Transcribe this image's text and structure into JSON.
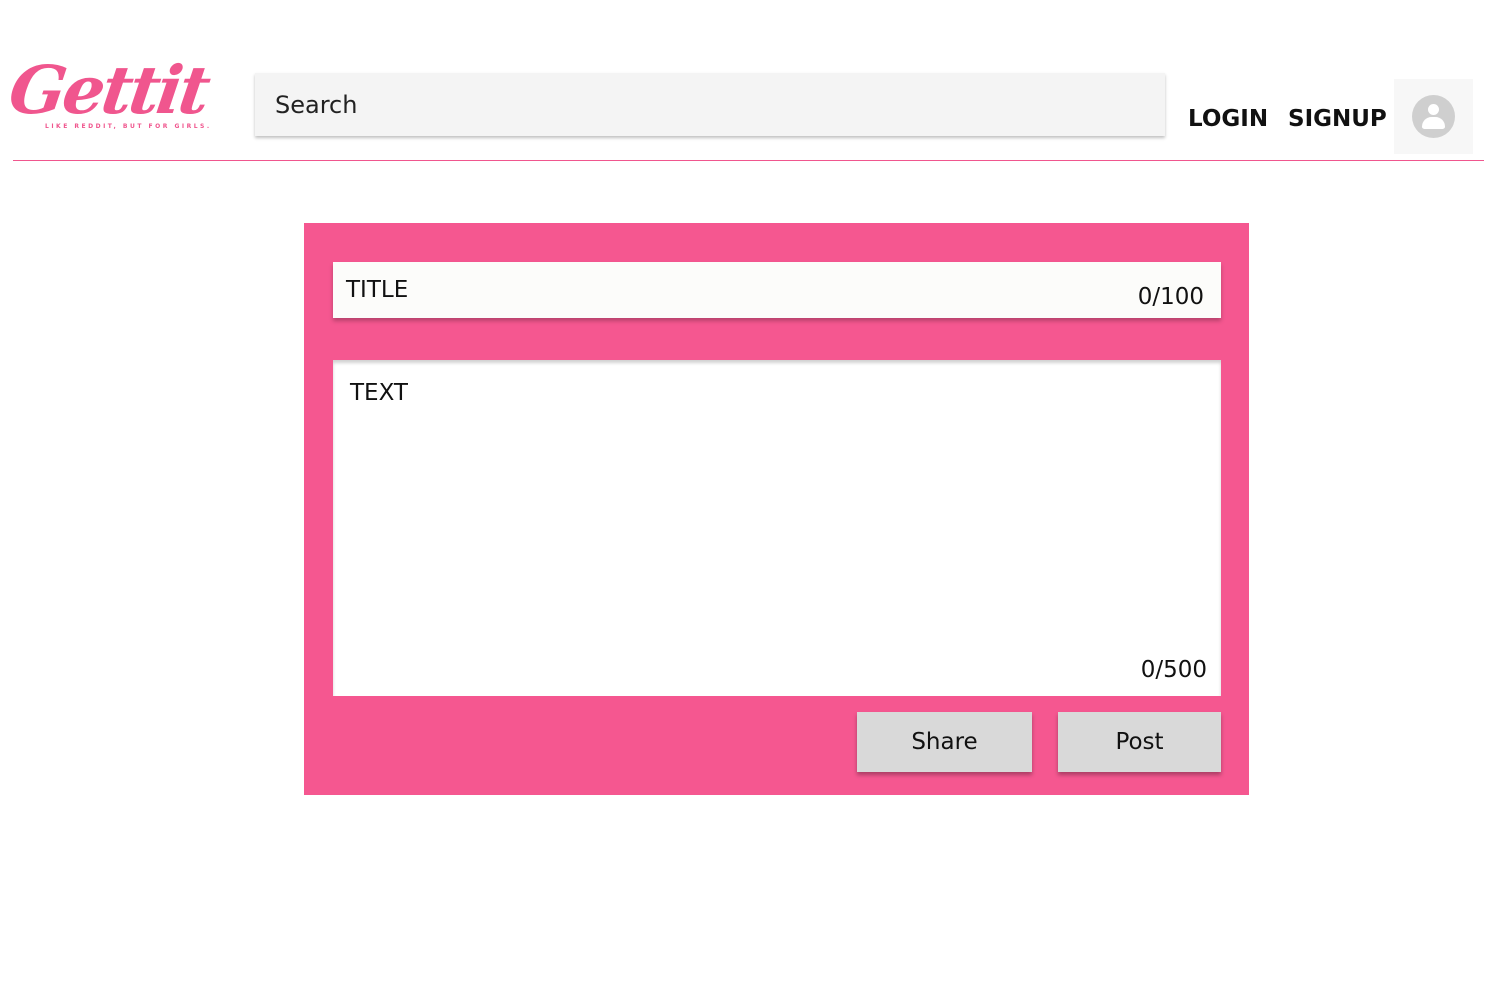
{
  "brand": {
    "name": "Gettit",
    "tagline": "LIKE REDDIT, BUT FOR GIRLS."
  },
  "search": {
    "placeholder": "Search"
  },
  "nav": {
    "login": "LOGIN",
    "signup": "SIGNUP",
    "avatar_icon": "user-avatar-icon"
  },
  "composer": {
    "title_placeholder": "TITLE",
    "title_counter": "0/100",
    "text_placeholder": "TEXT",
    "text_counter": "0/500",
    "share_label": "Share",
    "post_label": "Post"
  },
  "colors": {
    "accent": "#f55790",
    "brand": "#f0568e",
    "button": "#d9d9d9"
  }
}
